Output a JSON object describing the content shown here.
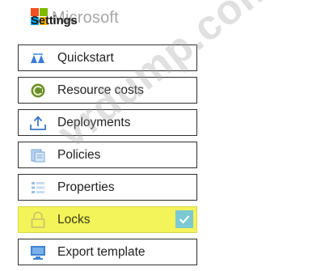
{
  "header": {
    "brand": "Microsoft",
    "section_title": "Settings"
  },
  "menu": {
    "items": [
      {
        "label": "Quickstart",
        "icon": "quickstart-icon"
      },
      {
        "label": "Resource costs",
        "icon": "resource-costs-icon"
      },
      {
        "label": "Deployments",
        "icon": "deployments-icon"
      },
      {
        "label": "Policies",
        "icon": "policies-icon"
      },
      {
        "label": "Properties",
        "icon": "properties-icon"
      },
      {
        "label": "Locks",
        "icon": "lock-icon",
        "selected": true
      },
      {
        "label": "Export template",
        "icon": "export-template-icon"
      }
    ]
  },
  "watermark": "vrdump.com",
  "colors": {
    "selected_highlight": "#f3f35a",
    "check_badge": "#7cc9d3",
    "logo_red": "#f25022",
    "logo_green": "#7fba00",
    "logo_blue": "#00a4ef",
    "logo_yellow": "#ffb900"
  }
}
